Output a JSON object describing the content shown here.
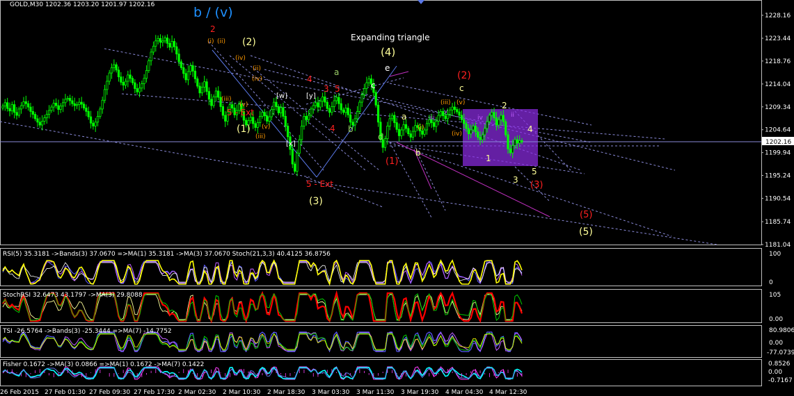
{
  "symbol_header": "GOLD,M30  1202.36 1203.20 1201.97 1202.16",
  "current_price": "1202.16",
  "price_axis": [
    "1228.16",
    "1223.44",
    "1218.76",
    "1214.04",
    "1209.34",
    "1204.64",
    "1199.94",
    "1195.24",
    "1190.54",
    "1185.74",
    "1181.04"
  ],
  "time_axis": [
    "26 Feb 2015",
    "27 Feb 01:30",
    "27 Feb 09:30",
    "27 Feb 17:30",
    "2 Mar 02:30",
    "2 Mar 10:30",
    "2 Mar 18:30",
    "3 Mar 03:30",
    "3 Mar 11:30",
    "3 Mar 19:30",
    "4 Mar 04:30",
    "4 Mar 12:30"
  ],
  "annotations": {
    "main_title": "b / (v)",
    "triangle_title": "Expanding triangle",
    "wave_4": "(4)",
    "wave_2": "(2)",
    "wave_1": "(1)",
    "wave_3": "(3)",
    "wave_5": "(5)",
    "wave_2_red": "(2)",
    "wave_1_red": "(1)",
    "wave_3_red": "(3)",
    "wave_5_red": "(5)",
    "ext_1": "5 - Ext",
    "ext_2": "5 - Ext",
    "label_a": "a",
    "label_b": "b",
    "label_c": "c",
    "label_d": "d",
    "label_e": "e",
    "label_a2": "a",
    "label_b2": "b",
    "label_c2": "c",
    "label_w": "[w]",
    "label_x": "[x]",
    "label_y": "[y]",
    "red_2": "2",
    "red_3": "3",
    "red_4": "4",
    "red_4b": "4",
    "red_5": "5",
    "yel_1": "1",
    "yel_2": "2",
    "yel_3": "3",
    "yel_4": "4",
    "yel_5": "5",
    "rn_i": "(i)",
    "rn_ii": "(ii)",
    "rn_iii": "(iii)",
    "rn_iv": "(iv)",
    "rn_v": "(v)",
    "rn_ii_2": "(ii)",
    "rn_iii_2": "(iii)",
    "rn_iv_2": "(iv)",
    "rn_v_2": "(v)",
    "rn_i_3": "(i)",
    "rn_iii_3": "(iii)",
    "rn_iv_3": "(iv)",
    "rn_v_3": "(v)",
    "m_iii": "iii",
    "m_iv": "iv",
    "m_v": "v",
    "m_ii": "ii"
  },
  "indicators": [
    {
      "label": "RSI(5) 35.3181  ->Bands(3) 37.0670  =>MA(1) 35.3181  ->MA(3) 37.0670  Stoch(21,3,3) 40.4125 36.8756",
      "scale": [
        "100",
        "0"
      ]
    },
    {
      "label": "StochRSI 32.6473 43.1797  ->MA(3) 29.8088",
      "scale": [
        "105",
        "0.00"
      ]
    },
    {
      "label": "TSI -26.5764  ->Bands(3) -25.3444  =>MA(7) -14.7752",
      "scale": [
        "80.9806",
        "0.00",
        "-77.0739"
      ]
    },
    {
      "label": "Fisher 0.1672  ->MA(3) 0.0866  =>MA(1) 0.1672  ->MA(7) 0.1422",
      "scale": [
        "0.8526",
        "0.00",
        "-0.7167"
      ]
    }
  ],
  "chart_data": {
    "type": "candlestick",
    "symbol": "GOLD",
    "timeframe": "M30",
    "last": {
      "open": 1202.36,
      "high": 1203.2,
      "low": 1201.97,
      "close": 1202.16
    },
    "ylim": [
      1181.04,
      1230.0
    ],
    "y_ticks": [
      1228.16,
      1223.44,
      1218.76,
      1214.04,
      1209.34,
      1204.64,
      1199.94,
      1195.24,
      1190.54,
      1185.74,
      1181.04
    ],
    "x_tick_labels": [
      "26 Feb 2015",
      "27 Feb 01:30",
      "27 Feb 09:30",
      "27 Feb 17:30",
      "2 Mar 02:30",
      "2 Mar 10:30",
      "2 Mar 18:30",
      "3 Mar 03:30",
      "3 Mar 11:30",
      "3 Mar 19:30",
      "4 Mar 04:30",
      "4 Mar 12:30"
    ],
    "closes": [
      1209.5,
      1210.2,
      1209.0,
      1208.5,
      1209.8,
      1208.2,
      1207.6,
      1208.9,
      1209.6,
      1210.4,
      1210.0,
      1209.3,
      1208.4,
      1207.8,
      1206.9,
      1206.2,
      1205.6,
      1206.4,
      1207.1,
      1207.8,
      1208.6,
      1209.3,
      1210.1,
      1209.6,
      1208.8,
      1209.5,
      1210.2,
      1210.9,
      1211.1,
      1210.6,
      1210.0,
      1209.6,
      1209.8,
      1210.3,
      1209.9,
      1209.1,
      1208.4,
      1207.3,
      1206.0,
      1205.4,
      1206.2,
      1207.4,
      1208.9,
      1210.7,
      1212.9,
      1214.6,
      1216.3,
      1217.4,
      1218.0,
      1216.9,
      1215.5,
      1214.4,
      1213.8,
      1214.6,
      1215.9,
      1215.2,
      1214.3,
      1213.1,
      1212.4,
      1213.2,
      1214.1,
      1215.2,
      1216.8,
      1218.8,
      1220.6,
      1221.8,
      1222.9,
      1223.4,
      1222.6,
      1222.9,
      1223.5,
      1222.4,
      1221.6,
      1222.8,
      1221.7,
      1220.2,
      1218.6,
      1217.4,
      1216.2,
      1214.9,
      1216.6,
      1217.8,
      1216.7,
      1215.1,
      1213.6,
      1212.2,
      1213.4,
      1214.5,
      1212.5,
      1210.9,
      1209.6,
      1211.4,
      1212.6,
      1211.3,
      1209.4,
      1207.6,
      1206.4,
      1208.3,
      1209.8,
      1209.1,
      1207.7,
      1208.6,
      1209.9,
      1208.4,
      1206.6,
      1205.6,
      1206.5,
      1207.2,
      1205.9,
      1205.1,
      1206.1,
      1207.4,
      1208.2,
      1207.5,
      1206.4,
      1207.3,
      1208.8,
      1210.3,
      1209.4,
      1208.1,
      1209.2,
      1207.4,
      1205.4,
      1203.2,
      1200.6,
      1197.6,
      1196.1,
      1199.8,
      1202.6,
      1205.4,
      1207.4,
      1206.7,
      1207.6,
      1208.9,
      1209.6,
      1210.2,
      1209.3,
      1210.5,
      1211.4,
      1210.3,
      1209.0,
      1208.2,
      1209.4,
      1210.6,
      1211.3,
      1210.0,
      1208.7,
      1208.2,
      1209.1,
      1207.7,
      1206.2,
      1205.6,
      1206.9,
      1208.4,
      1210.3,
      1211.8,
      1213.1,
      1214.3,
      1215.1,
      1214.0,
      1212.3,
      1209.7,
      1206.2,
      1202.6,
      1201.0,
      1202.8,
      1205.4,
      1206.9,
      1207.6,
      1206.1,
      1204.7,
      1203.4,
      1204.6,
      1205.7,
      1204.9,
      1203.8,
      1203.1,
      1204.3,
      1205.5,
      1205.1,
      1204.4,
      1203.7,
      1204.6,
      1205.9,
      1206.7,
      1206.1,
      1205.3,
      1206.4,
      1207.6,
      1208.4,
      1207.5,
      1206.9,
      1207.8,
      1208.7,
      1209.3,
      1208.8,
      1208.3,
      1207.6,
      1206.7,
      1205.9,
      1204.9,
      1203.8,
      1204.6,
      1205.4,
      1204.2,
      1203.1,
      1202.6,
      1203.6,
      1204.9,
      1206.3,
      1207.6,
      1208.2,
      1207.1,
      1205.6,
      1206.7,
      1207.6,
      1206.3,
      1203.6,
      1200.7,
      1199.9,
      1201.4,
      1202.6,
      1201.9,
      1202.4,
      1202.16
    ],
    "panels": [
      "RSI(5)",
      "StochRSI",
      "TSI",
      "Fisher"
    ]
  },
  "colors": {
    "background": "#000000",
    "bull": "#00ff00",
    "bear": "#00ff00",
    "grid_frame": "#c0c0c0",
    "trend_lines": "#8a8ad8",
    "box": "#8a2be2",
    "title_blue": "#1e90ff",
    "wave_yellow": "#ffff99",
    "wave_red": "#ff2020",
    "roman_orange": "#ff9900",
    "roman_magenta": "#c060ff"
  }
}
